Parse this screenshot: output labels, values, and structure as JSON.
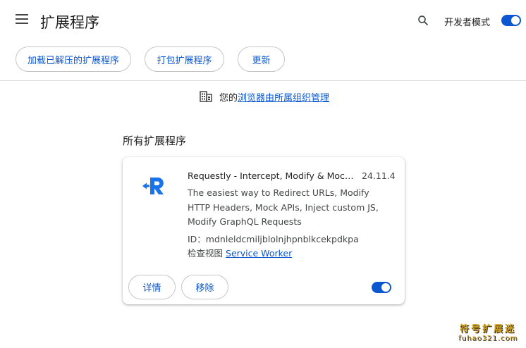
{
  "header": {
    "title": "扩展程序",
    "search_icon": "search-icon",
    "dev_mode_label": "开发者模式",
    "dev_mode_on": true
  },
  "actions": {
    "load_unpacked": "加载已解压的扩展程序",
    "pack": "打包扩展程序",
    "update": "更新"
  },
  "managed": {
    "prefix": "您的",
    "link": "浏览器由所属组织管理"
  },
  "section": {
    "title": "所有扩展程序"
  },
  "extension": {
    "name": "Requestly - Intercept, Modify & Mock HTTP Requests",
    "version": "24.11.4",
    "description": "The easiest way to Redirect URLs, Modify HTTP Headers, Mock APIs, Inject custom JS, Modify GraphQL Requests",
    "id_text": "ID：mdnleldcmiljblolnjhpnblkcekpdkpa",
    "views_label": "检查视图",
    "views_link": "Service Worker",
    "details_label": "详情",
    "remove_label": "移除",
    "enabled": true
  },
  "watermark": {
    "cn": "符号扩展迷",
    "en": "fuhao321.com"
  },
  "colors": {
    "accent": "#0b57d0",
    "logo_blue": "#1a73e8"
  }
}
